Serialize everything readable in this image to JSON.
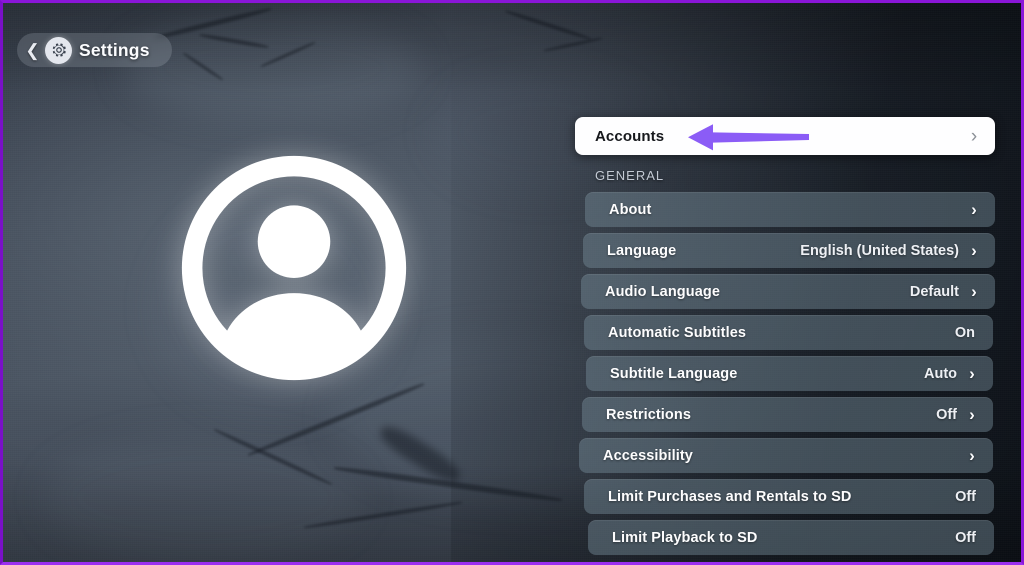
{
  "window": {
    "frame_color": "#8a16d8",
    "background_description": "dark cloudy sky"
  },
  "header": {
    "back_icon": "back-chevron-icon",
    "gear_icon": "gear-icon",
    "title": "Settings"
  },
  "avatar": {
    "icon": "person-avatar-icon",
    "color": "#ffffff"
  },
  "annotation": {
    "arrow_icon": "left-arrow-annotation",
    "color": "#8b5cf6",
    "points_at": "Accounts"
  },
  "list": {
    "focused_row": {
      "label": "Accounts",
      "chevron": "›",
      "focused": true
    },
    "section_label": "GENERAL",
    "rows": [
      {
        "label": "About",
        "value": "",
        "chevron": true
      },
      {
        "label": "Language",
        "value": "English (United States)",
        "chevron": true
      },
      {
        "label": "Audio Language",
        "value": "Default",
        "chevron": true
      },
      {
        "label": "Automatic Subtitles",
        "value": "On",
        "chevron": false
      },
      {
        "label": "Subtitle Language",
        "value": "Auto",
        "chevron": true
      },
      {
        "label": "Restrictions",
        "value": "Off",
        "chevron": true
      },
      {
        "label": "Accessibility",
        "value": "",
        "chevron": true
      },
      {
        "label": "Limit Purchases and Rentals to SD",
        "value": "Off",
        "chevron": false
      },
      {
        "label": "Limit Playback to SD",
        "value": "Off",
        "chevron": false
      }
    ],
    "chevron_glyph": "›"
  },
  "colors": {
    "row_background": "#768c98",
    "focused_row_background": "#fefeff",
    "accent_purple": "#8b5cf6",
    "label_text": "#fdfdfe",
    "section_text": "#c3cad4"
  }
}
